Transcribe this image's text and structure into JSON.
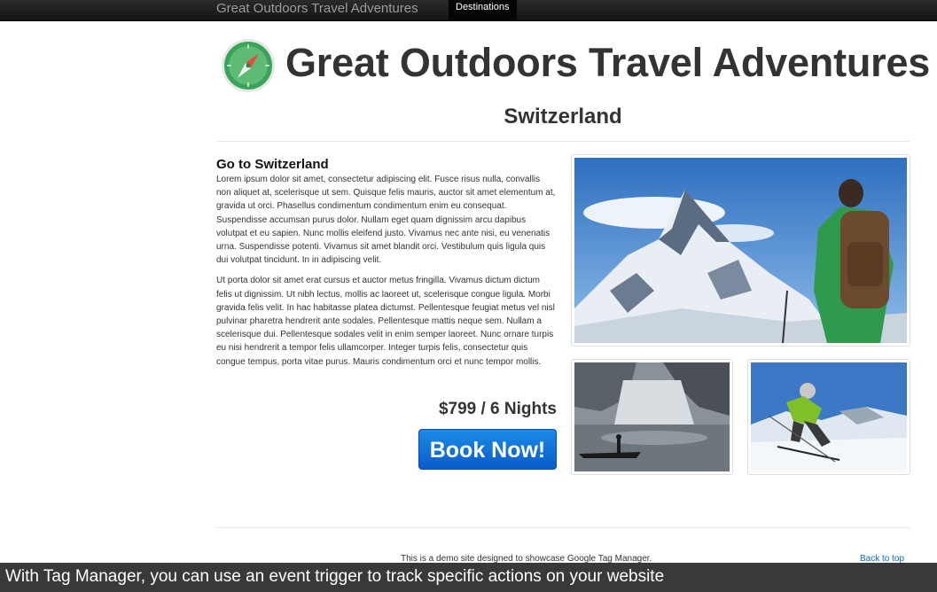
{
  "navbar": {
    "brand": "Great Outdoors Travel Adventures",
    "tab_destinations": "Destinations"
  },
  "header": {
    "site_title": "Great Outdoors Travel Adventures",
    "logo_icon": "compass-icon"
  },
  "page": {
    "title": "Switzerland"
  },
  "article": {
    "heading": "Go to Switzerland",
    "paragraphs": [
      "Lorem ipsum dolor sit amet, consectetur adipiscing elit. Fusce risus nulla, convallis non aliquet at, scelerisque ut sem. Quisque felis mauris, auctor sit amet elementum at, gravida ut orci. Phasellus condimentum condimentum enim eu consequat. Suspendisse accumsan purus dolor. Nullam eget quam dignissim arcu dapibus volutpat et eu sapien. Nunc mollis eleifend justo. Vivamus nec ante nisi, eu venenatis urna. Suspendisse potenti. Vivamus sit amet blandit orci. Vestibulum quis ligula quis dui volutpat tincidunt. In in adipiscing velit.",
      "Ut porta dolor sit amet erat cursus et auctor metus fringilla. Vivamus dictum dictum felis ut dignissim. Ut nibh lectus, mollis ac laoreet ut, scelerisque congue ligula. Morbi gravida felis velit. In hac habitasse platea dictumst. Pellentesque feugiat metus vel nisl pulvinar pharetra hendrerit ante sodales. Pellentesque mattis neque sem. Nullam a scelerisque dui. Pellentesque sodales velit in enim semper laoreet. Nunc ornare turpis eu nisi hendrerit a tempor felis ullamcorper. Integer turpis felis, consectetur quis congue tempus, porta vitae purus. Mauris condimentum orci et nunc tempor mollis."
    ],
    "price": "$799 / 6 Nights",
    "book_button": "Book Now!"
  },
  "footer": {
    "text": "This is a demo site designed to showcase Google Tag Manager.",
    "back_to_top": "Back to top"
  },
  "caption": {
    "text": "With Tag Manager, you can use an event trigger to track specific actions on your website"
  },
  "colors": {
    "navbar": "#1c1c1c",
    "button": "#0a6fd8",
    "link": "#0b68c8"
  }
}
